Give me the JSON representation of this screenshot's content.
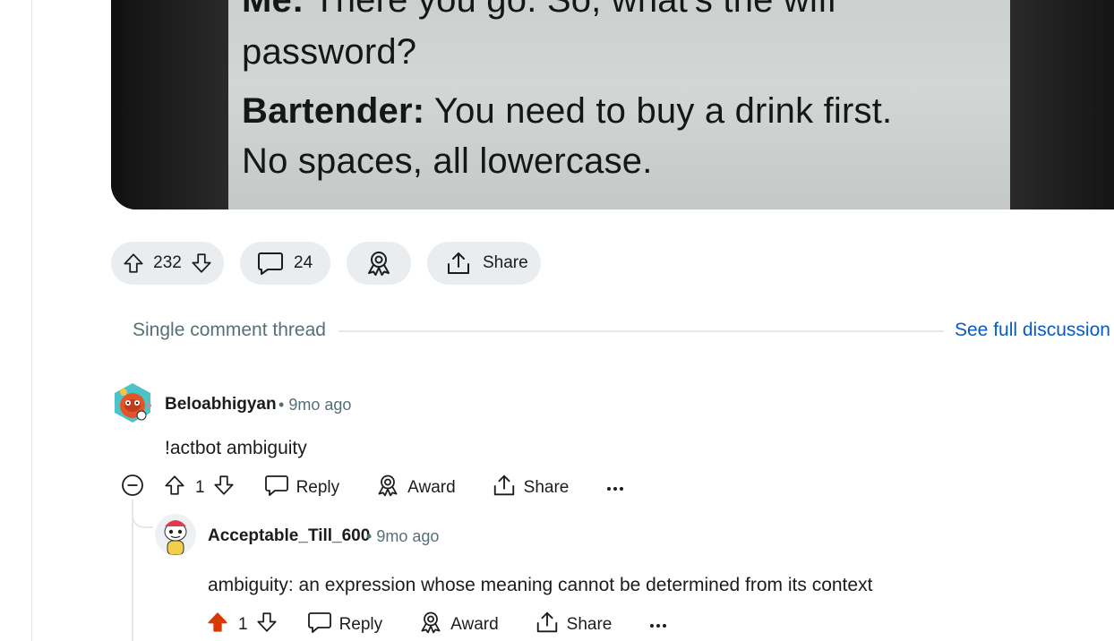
{
  "post": {
    "image_lines": [
      {
        "speaker": "Me:",
        "text": " There you go. So, what's the wifi"
      },
      {
        "speaker": "",
        "text": "password?"
      },
      {
        "speaker": "Bartender:",
        "text": " You need to buy a drink first."
      },
      {
        "speaker": "",
        "text": "No spaces, all lowercase."
      }
    ],
    "score": "232",
    "comment_count": "24",
    "share_label": "Share"
  },
  "thread": {
    "label": "Single comment thread",
    "full_link": "See full discussion"
  },
  "comments": [
    {
      "username": "Beloabhigyan",
      "time": "9mo ago",
      "body": "!actbot ambiguity",
      "score": "1",
      "reply_label": "Reply",
      "award_label": "Award",
      "share_label": "Share"
    },
    {
      "username": "Acceptable_Till_600",
      "time": "9mo ago",
      "body": "ambiguity: an expression whose meaning cannot be determined from its context",
      "score": "1",
      "reply_label": "Reply",
      "award_label": "Award",
      "share_label": "Share",
      "upvoted": true
    }
  ],
  "colors": {
    "upvote_active": "#d93900",
    "link": "#0a5ac4",
    "pill_bg": "#e9edf0",
    "meta": "#576f76"
  },
  "icons": [
    "upvote-icon",
    "downvote-icon",
    "comment-icon",
    "award-icon",
    "share-icon",
    "collapse-icon",
    "more-icon",
    "reply-icon"
  ]
}
